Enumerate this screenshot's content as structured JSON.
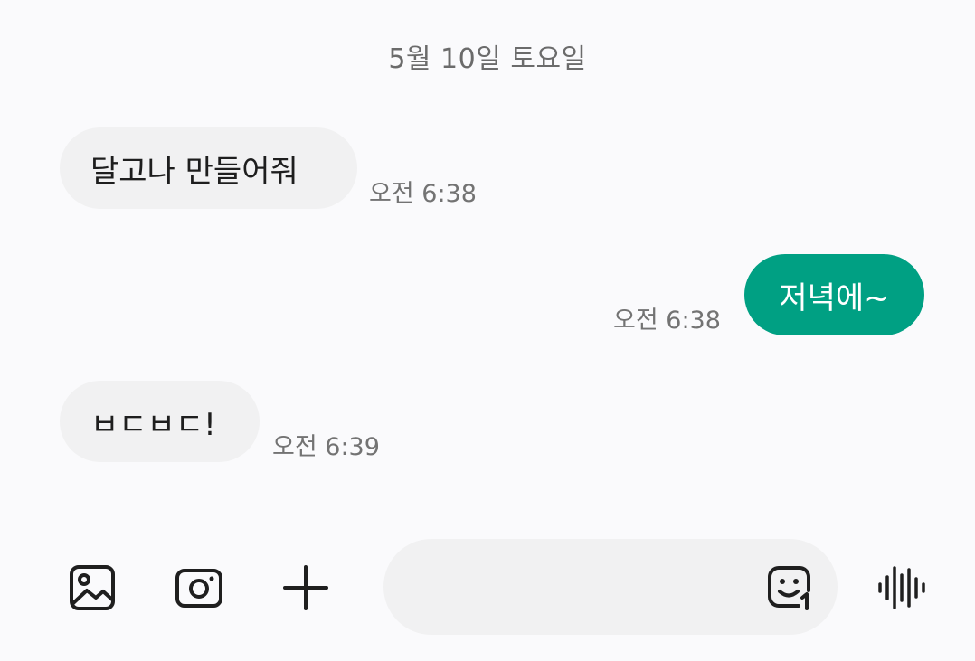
{
  "date_divider": "5월 10일 토요일",
  "messages": [
    {
      "direction": "incoming",
      "text": "달고나 만들어줘",
      "time": "오전 6:38"
    },
    {
      "direction": "outgoing",
      "text": "저녁에~",
      "time": "오전 6:38"
    },
    {
      "direction": "incoming",
      "text": "ㅂㄷㅂㄷ!",
      "time": "오전 6:39"
    }
  ],
  "composer": {
    "input_value": "",
    "input_placeholder": "",
    "icons": [
      "gallery-icon",
      "camera-icon",
      "plus-icon",
      "sticker-icon",
      "voice-wave-icon"
    ]
  },
  "colors": {
    "background": "#fafafc",
    "incoming_bubble": "#f1f1f2",
    "outgoing_bubble": "#00a083",
    "timestamp": "#737373",
    "icon": "#1f1f1f"
  }
}
